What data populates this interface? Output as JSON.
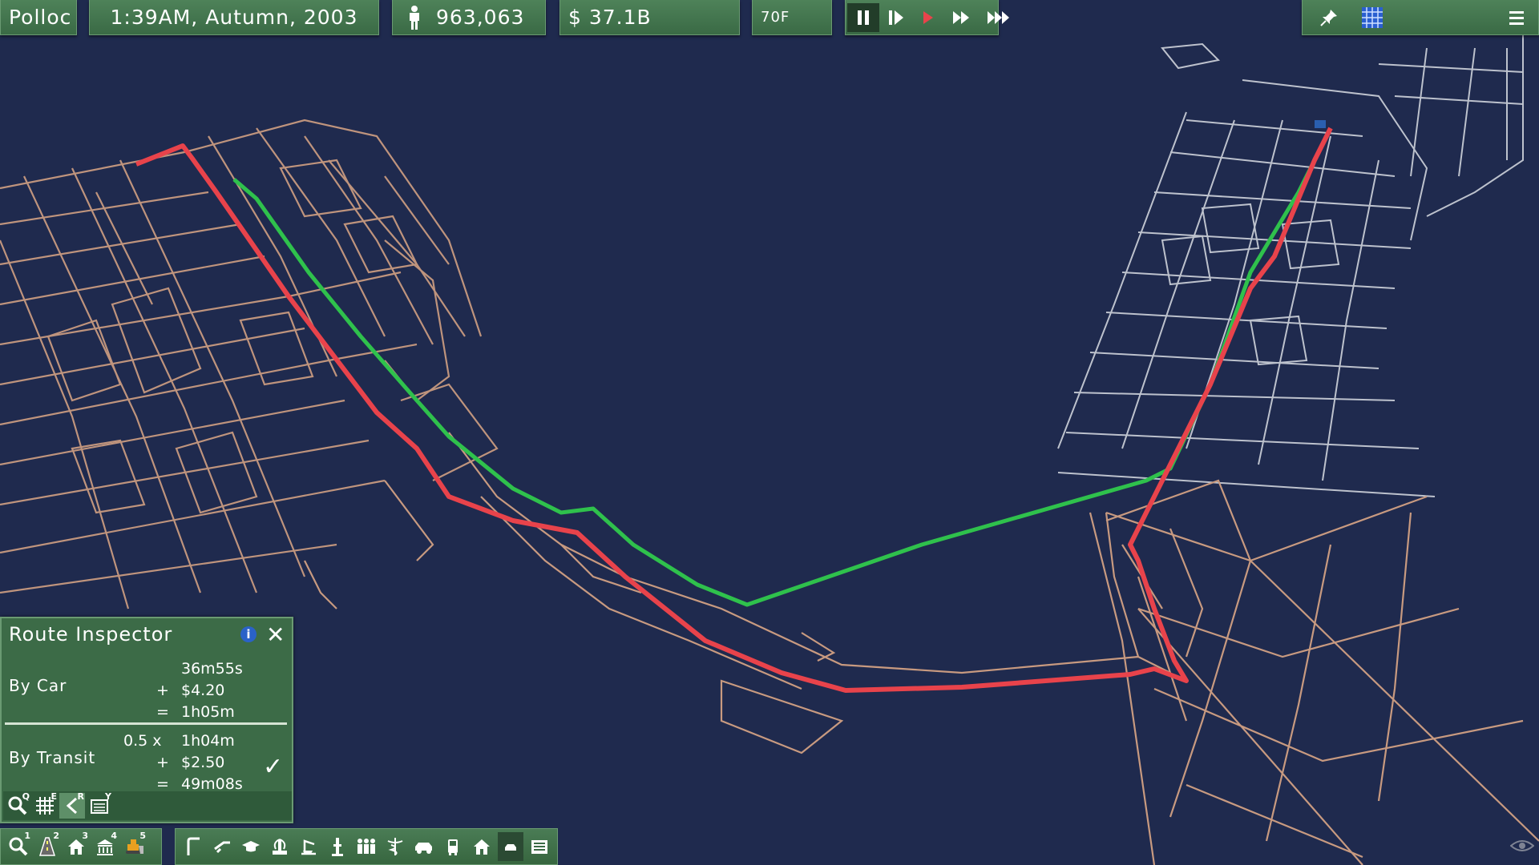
{
  "topbar": {
    "city_name": "Polloc",
    "datetime": "1:39AM,  Autumn,  2003",
    "population": "963,063",
    "money": "$ 37.1B",
    "temperature": "70F"
  },
  "route_inspector": {
    "title": "Route  Inspector",
    "by_car": {
      "label": "By  Car",
      "time": "36m55s",
      "cost_op": "+",
      "cost": "$4.20",
      "total_op": "=",
      "total": "1h05m"
    },
    "by_transit": {
      "label": "By  Transit",
      "multiplier": "0.5  x",
      "time": "1h04m",
      "cost_op": "+",
      "cost": "$2.50",
      "total_op": "=",
      "total": "49m08s"
    },
    "tools": [
      {
        "icon": "query-icon",
        "key": "Q"
      },
      {
        "icon": "grid-icon",
        "key": "E"
      },
      {
        "icon": "route-icon",
        "key": "R"
      },
      {
        "icon": "list-icon",
        "key": "Y"
      }
    ]
  },
  "bottom_left_tools": [
    {
      "icon": "query-icon",
      "key": "1"
    },
    {
      "icon": "road-icon",
      "key": "2"
    },
    {
      "icon": "zone-icon",
      "key": "3"
    },
    {
      "icon": "building-icon",
      "key": "4"
    },
    {
      "icon": "bulldoze-icon",
      "key": "5"
    }
  ],
  "colors": {
    "map_bg": "#1f2a4e",
    "panel_bg": "#3c6b47",
    "route_car": "#e8434b",
    "route_transit": "#2fc14c",
    "road_left": "#c89a80",
    "road_right": "#cfd3db"
  }
}
